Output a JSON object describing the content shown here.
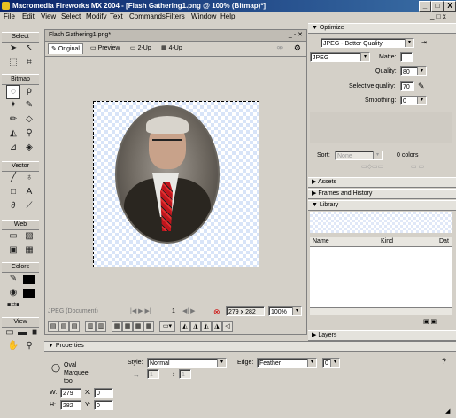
{
  "window": {
    "title": "Macromedia Fireworks MX 2004 - [Flash Gathering1.png @ 100% (Bitmap)*]",
    "min": "_",
    "max": "□",
    "close": "X"
  },
  "menu": [
    "File",
    "Edit",
    "View",
    "Select",
    "Modify",
    "Text",
    "Commands",
    "Filters",
    "Window",
    "Help"
  ],
  "tools": {
    "select": "Select",
    "bitmap": "Bitmap",
    "vector": "Vector",
    "web": "Web",
    "colors": "Colors",
    "view": "View"
  },
  "document": {
    "title": "Flash Gathering1.png*",
    "tabs": [
      "Original",
      "Preview",
      "2-Up",
      "4-Up"
    ],
    "status_left": "JPEG (Document)",
    "page": "1",
    "size": "279 x 282",
    "zoom": "100%"
  },
  "optimize": {
    "header": "Optimize",
    "preset": "JPEG - Better Quality",
    "format": "JPEG",
    "matte_label": "Matte:",
    "quality_label": "Quality:",
    "quality": "80",
    "selective_label": "Selective quality:",
    "selective": "70",
    "smoothing_label": "Smoothing:",
    "smoothing": "0",
    "sort_label": "Sort:",
    "sort": "None",
    "colors": "0 colors"
  },
  "panels": {
    "assets": "Assets",
    "frames": "Frames and History",
    "library": "Library",
    "layers": "Layers"
  },
  "library": {
    "columns": [
      "Name",
      "Kind",
      "Dat"
    ]
  },
  "properties": {
    "header": "Properties",
    "tool_name": "Oval Marquee tool",
    "style_label": "Style:",
    "style": "Normal",
    "edge_label": "Edge:",
    "edge": "Feather",
    "edge_value": "0",
    "w_label": "W:",
    "w": "279",
    "h_label": "H:",
    "h": "282",
    "x_label": "X:",
    "x": "0",
    "y_label": "Y:",
    "y": "0",
    "ratio_w": "1",
    "ratio_h": "1"
  }
}
